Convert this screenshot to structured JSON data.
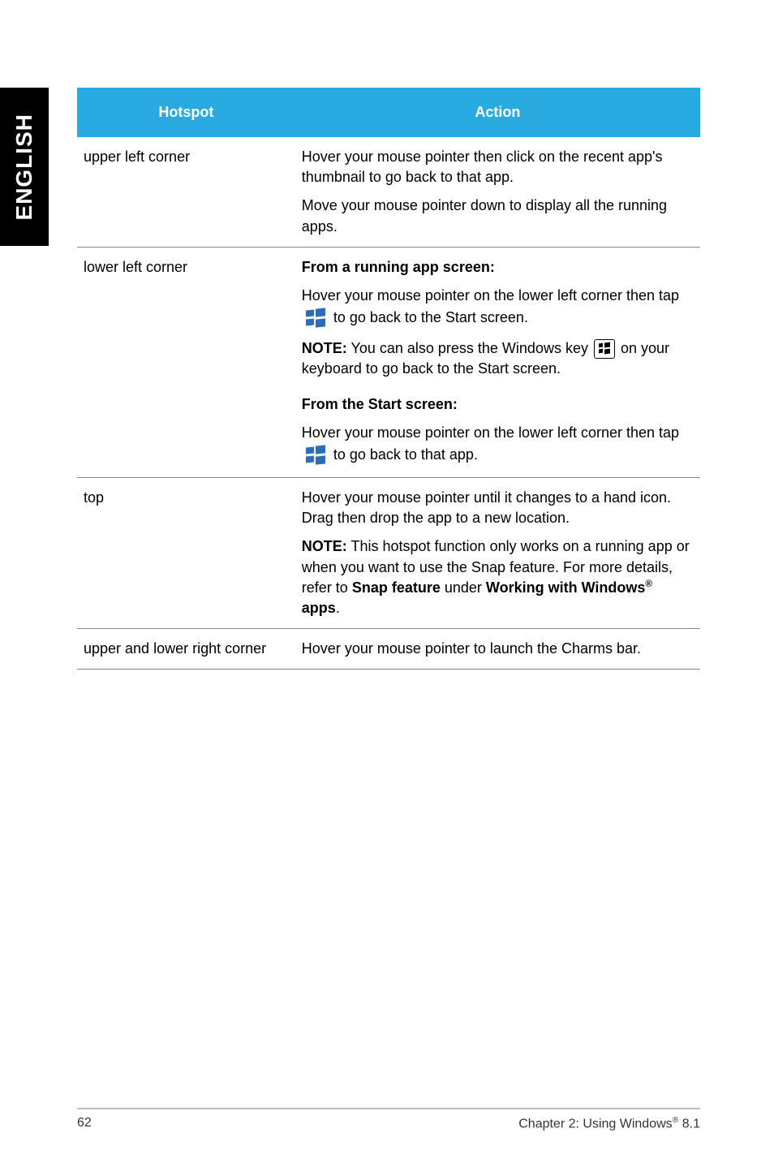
{
  "sideTab": "ENGLISH",
  "table": {
    "headers": {
      "hotspot": "Hotspot",
      "action": "Action"
    },
    "rows": {
      "upperLeft": {
        "hotspot": "upper left corner",
        "p1": "Hover your mouse pointer then click on the recent app's thumbnail to go back to that app.",
        "p2": "Move your mouse pointer down to display all the running apps."
      },
      "lowerLeft": {
        "hotspot": "lower left corner",
        "h1": "From a running app screen:",
        "p1a": "Hover your mouse pointer on the lower left corner then tap ",
        "p1b": " to go back to the Start screen.",
        "noteLabel": "NOTE:",
        "noteA": "  You can also press the Windows key ",
        "noteB": " on your keyboard to go back to the Start screen.",
        "h2": "From the Start screen:",
        "p2a": "Hover your mouse pointer on the lower left corner then tap ",
        "p2b": " to go back to that app."
      },
      "top": {
        "hotspot": "top",
        "p1": "Hover your mouse pointer until it changes to a hand icon. Drag then drop the app to a new location.",
        "noteLabel": "NOTE:",
        "noteA": "  This hotspot function only works on a running app or when you want to use the Snap feature. For more details, refer to ",
        "noteB": "Snap feature",
        "noteC": " under ",
        "noteD": "Working with Windows",
        "noteE": " apps",
        "noteF": "."
      },
      "upperLowerRight": {
        "hotspot": "upper and lower right corner",
        "p1": "Hover your mouse pointer to launch the Charms bar."
      }
    }
  },
  "footer": {
    "page": "62",
    "chapterA": "Chapter 2: Using Windows",
    "chapterB": " 8.1"
  }
}
